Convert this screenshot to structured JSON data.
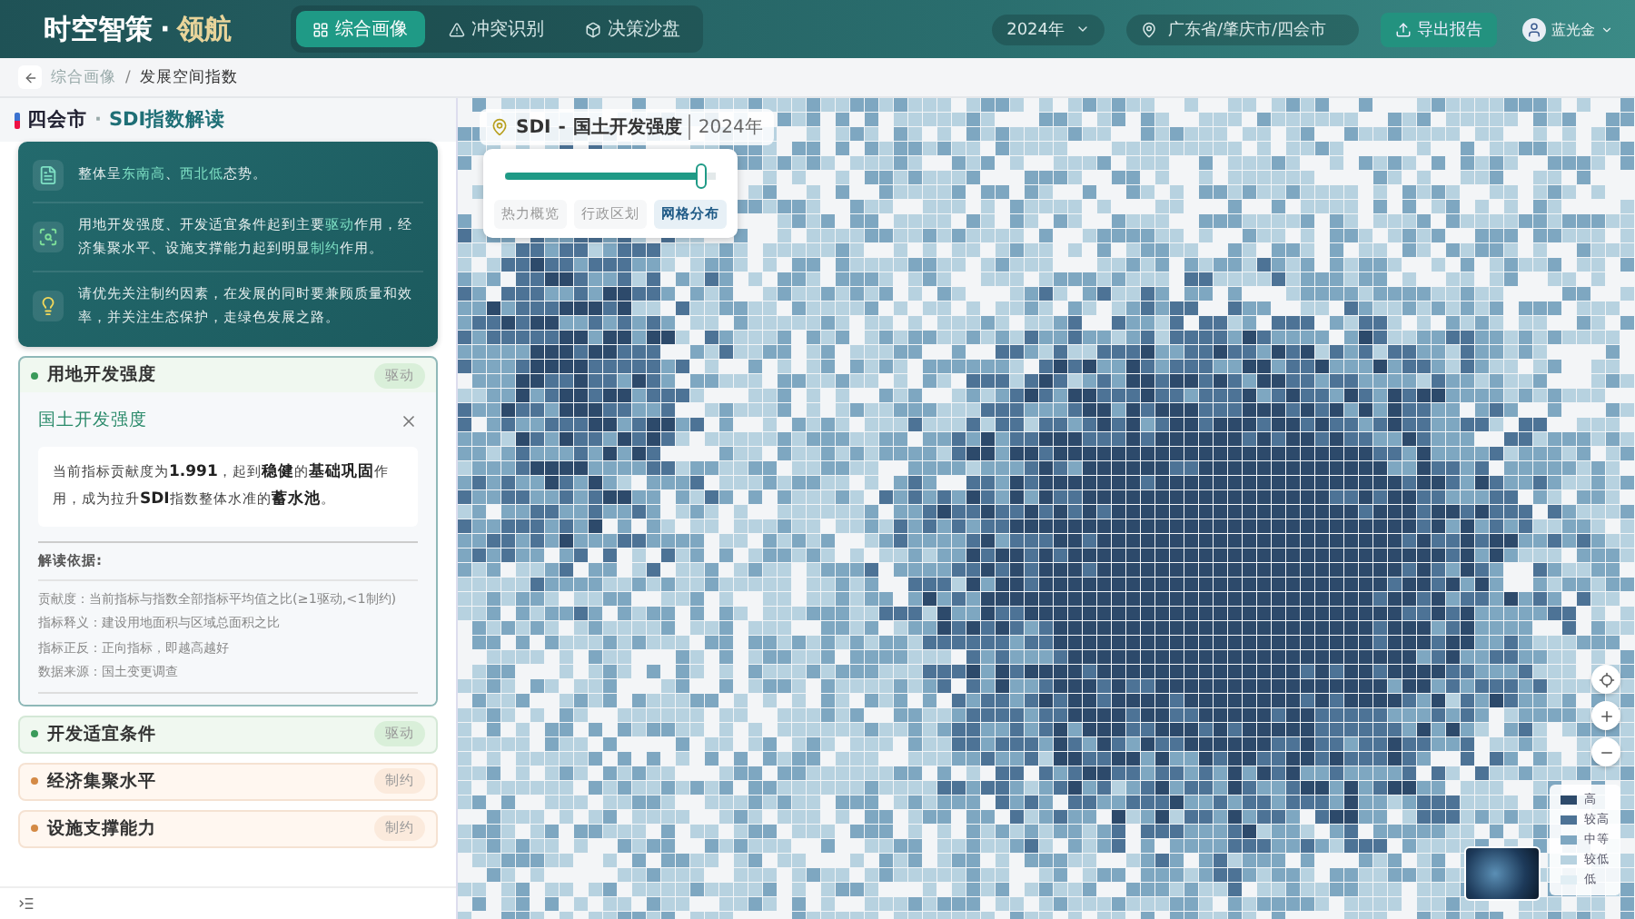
{
  "header": {
    "brand": "时空智策",
    "brand_separator": "·",
    "brand_accent": "领航",
    "nav": [
      {
        "label": "综合画像",
        "selected": true
      },
      {
        "label": "冲突识别",
        "selected": false
      },
      {
        "label": "决策沙盘",
        "selected": false
      }
    ],
    "year": "2024年",
    "region": "广东省/肇庆市/四会市",
    "export": "导出报告",
    "user": "蓝光金"
  },
  "breadcrumb": {
    "items": [
      "综合画像",
      "发展空间指数"
    ],
    "separator": "/"
  },
  "panel": {
    "city": "四会市",
    "separator": "·",
    "title": "SDI指数解读"
  },
  "insights": [
    {
      "text": "整体呈**东南高**、**西北低**态势。"
    },
    {
      "text": "用地开发强度、开发适宜条件起到主要**驱动**作用，经济集聚水平、设施支撑能力起到明显**制约**作用。"
    },
    {
      "text": "请优先关注制约因素，在发展的同时要兼顾质量和效率，并关注生态保护，走绿色发展之路。"
    }
  ],
  "factors": [
    {
      "name": "用地开发强度",
      "tag": "驱动",
      "kind": "drive",
      "expanded": true,
      "detail": {
        "title": "国土开发强度",
        "summary": "当前指标贡献度为**1.991**，起到**稳健**的**基础巩固**作用，成为拉升**SDI**指数整体水准的**蓄水池**。",
        "basis_title": "解读依据:",
        "basis": [
          "贡献度：当前指标与指数全部指标平均值之比(≥1驱动,<1制约)",
          "指标释义：建设用地面积与区域总面积之比",
          "指标正反：正向指标，即越高越好",
          "数据来源：国土变更调查"
        ]
      }
    },
    {
      "name": "开发适宜条件",
      "tag": "驱动",
      "kind": "drive",
      "expanded": false
    },
    {
      "name": "经济集聚水平",
      "tag": "制约",
      "kind": "constrain",
      "expanded": false
    },
    {
      "name": "设施支撑能力",
      "tag": "制约",
      "kind": "constrain",
      "expanded": false
    }
  ],
  "map": {
    "prefix": "SDI",
    "title_separator": "-",
    "title": "国土开发强度",
    "year": "2024年",
    "slider": {
      "level": 0.93
    },
    "views": [
      {
        "label": "热力概览",
        "selected": false
      },
      {
        "label": "行政区划",
        "selected": false
      },
      {
        "label": "网格分布",
        "selected": true
      }
    ],
    "legend": [
      {
        "label": "高",
        "color": "#2d4a6b"
      },
      {
        "label": "较高",
        "color": "#4d7396"
      },
      {
        "label": "中等",
        "color": "#7ea7c1"
      },
      {
        "label": "较低",
        "color": "#b7d2e0"
      },
      {
        "label": "低",
        "color": "#e1eef4"
      }
    ]
  }
}
